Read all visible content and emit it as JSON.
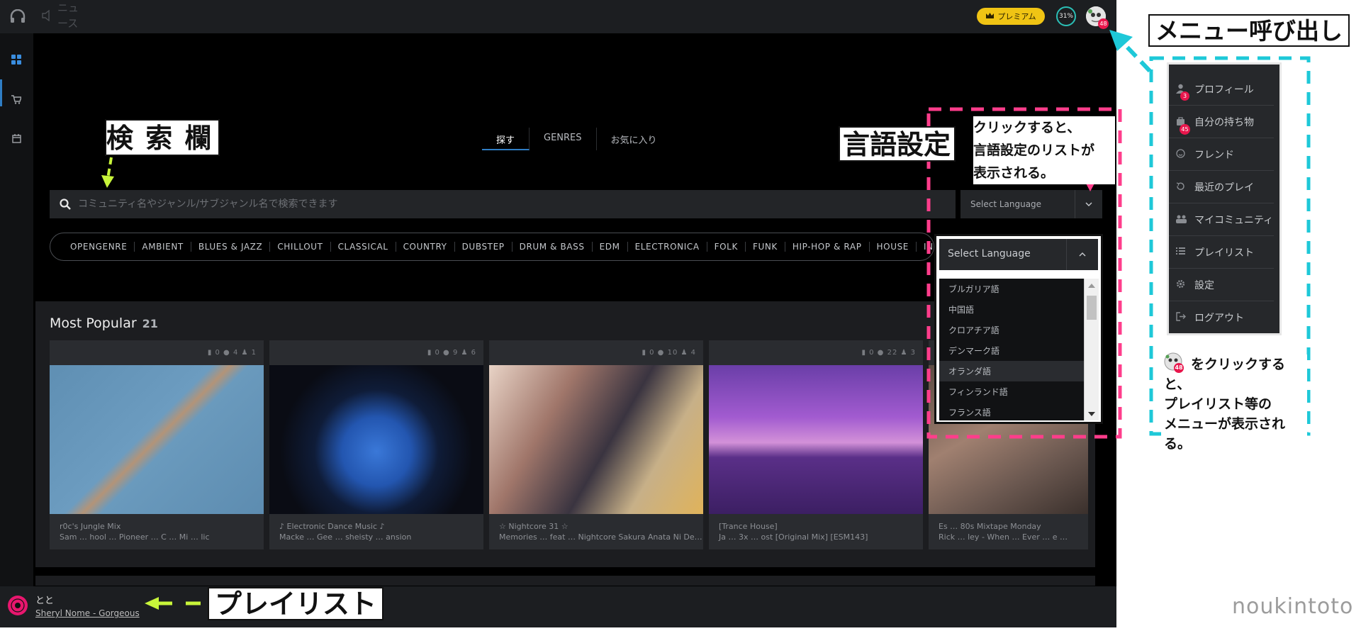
{
  "topbar": {
    "news_label": "ニュース",
    "premium_label": "プレミアム",
    "progress_percent": "31%",
    "avatar_badge": "48"
  },
  "tabs": [
    {
      "label": "探す"
    },
    {
      "label": "GENRES"
    },
    {
      "label": "お気に入り"
    }
  ],
  "search": {
    "placeholder": "コミュニティ名やジャンル/サブジャンル名で検索できます"
  },
  "language": {
    "selected": "Select Language"
  },
  "genres": [
    "OPENGENRE",
    "AMBIENT",
    "BLUES & JAZZ",
    "CHILLOUT",
    "CLASSICAL",
    "COUNTRY",
    "DUBSTEP",
    "DRUM & BASS",
    "EDM",
    "ELECTRONICA",
    "FOLK",
    "FUNK",
    "HIP-HOP & RAP",
    "HOUSE",
    "IND"
  ],
  "most_popular": {
    "title": "Most Popular",
    "count": "21"
  },
  "cards": [
    {
      "stats": "▮ 0  ● 4  ♟ 1",
      "title": "r0c's Jungle Mix",
      "subtitle": "Sam … hool … Pioneer … C … Mi … lic"
    },
    {
      "stats": "▮ 0  ● 9  ♟ 6",
      "title": "♪ Electronic Dance Music ♪",
      "subtitle": "Macke … Gee … sheisty … ansion"
    },
    {
      "stats": "▮ 0  ● 10  ♟ 4",
      "title": "☆ Nightcore 31 ☆",
      "subtitle": "Memories … feat … Nightcore Sakura Anata Ni De…"
    },
    {
      "stats": "▮ 0  ● 22  ♟ 3",
      "title": "[Trance House]",
      "subtitle": "Ja … 3x … ost [Original Mix] [ESM143]"
    },
    {
      "stats": "",
      "title": "Es … 80s Mixtape Monday",
      "subtitle": "Rick … ley - When … Ever … e … "
    }
  ],
  "player": {
    "title": "とと",
    "subtitle": "Sheryl Nome - Gorgeous"
  },
  "language_dropdown": {
    "header": "Select Language",
    "options": [
      "ブルガリア語",
      "中国語",
      "クロアチア語",
      "デンマーク語",
      "オランダ語",
      "フィンランド語",
      "フランス語"
    ]
  },
  "user_menu": {
    "items": [
      {
        "label": "プロフィール",
        "badge": "3"
      },
      {
        "label": "自分の持ち物",
        "badge": "45"
      },
      {
        "label": "フレンド"
      },
      {
        "label": "最近のプレイ"
      },
      {
        "label": "マイコミュニティ"
      },
      {
        "label": "プレイリスト"
      },
      {
        "label": "設定"
      },
      {
        "label": "ログアウト"
      }
    ]
  },
  "annotations": {
    "search_label": "検 索 欄",
    "language_label": "言語設定",
    "language_note": "クリックすると、\n言語設定のリストが\n表示される。",
    "menu_label": "メニュー呼び出し",
    "menu_note_badge": "48",
    "menu_note": "をクリックすると、\nプレイリスト等の\nメニューが表示される。",
    "playlist_label": "プレイリスト"
  },
  "watermark": "noukintoto",
  "colors": {
    "accent_blue": "#2f7dc4",
    "annotation_pink": "#ff3d8b",
    "annotation_cyan": "#1ec8d8",
    "annotation_green": "#c8f53a",
    "premium_gold": "#f0c414",
    "badge_red": "#e8164c"
  }
}
